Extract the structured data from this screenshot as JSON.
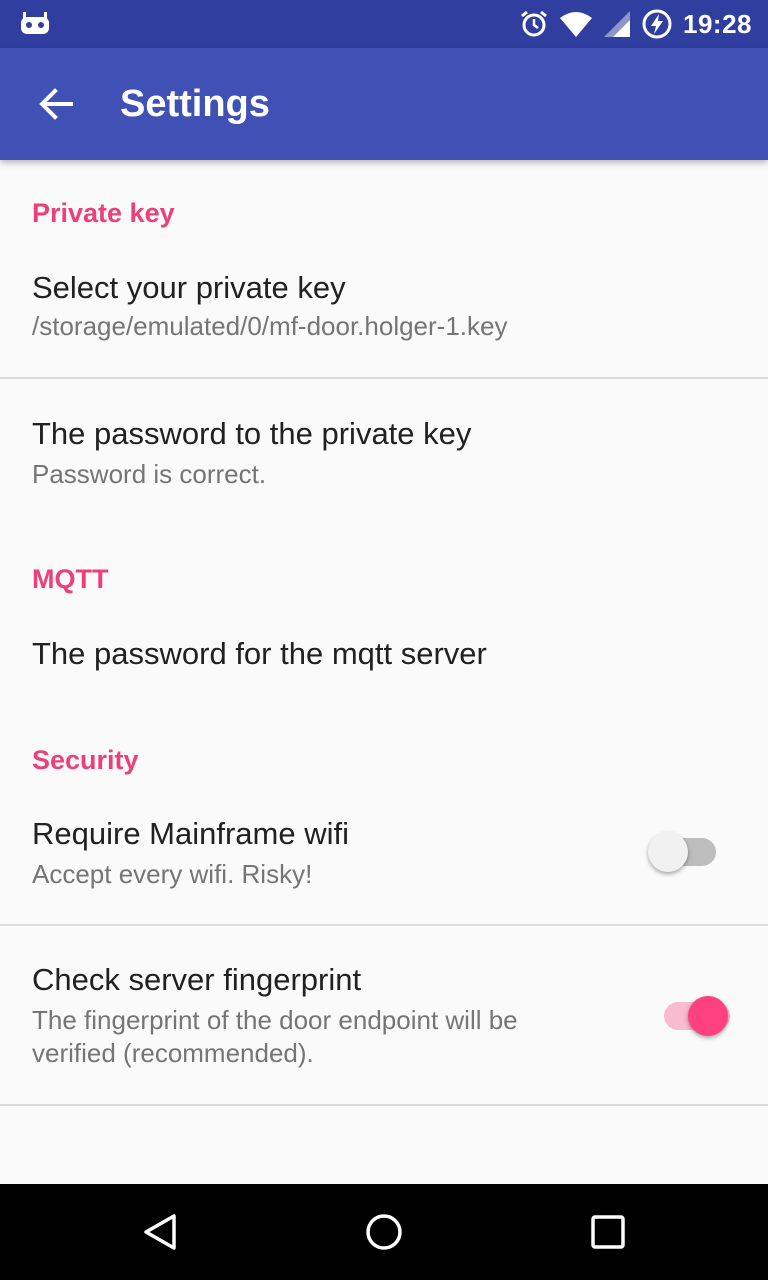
{
  "status_bar": {
    "time": "19:28",
    "icons": [
      "android-debug-icon",
      "alarm-icon",
      "wifi-icon",
      "signal-icon",
      "battery-charging-icon"
    ]
  },
  "toolbar": {
    "title": "Settings",
    "back_icon": "arrow-back-icon"
  },
  "sections": {
    "private_key": {
      "header": "Private key",
      "select_key": {
        "title": "Select your private key",
        "summary": "/storage/emulated/0/mf-door.holger-1.key"
      },
      "key_password": {
        "title": "The password to the private key",
        "summary": "Password is correct."
      }
    },
    "mqtt": {
      "header": "MQTT",
      "server_password": {
        "title": "The password for the mqtt server"
      }
    },
    "security": {
      "header": "Security",
      "require_wifi": {
        "title": "Require Mainframe wifi",
        "summary": "Accept every wifi. Risky!",
        "checked": false
      },
      "check_fingerprint": {
        "title": "Check server fingerprint",
        "summary": "The fingerprint of the door endpoint will be verified (recommended).",
        "checked": true
      }
    }
  },
  "colors": {
    "status_bar": "#303f9f",
    "toolbar": "#3f51b5",
    "accent": "#ec407a",
    "switch_on_thumb": "#ff4081",
    "switch_on_track": "#f8bbd0"
  },
  "nav_bar": {
    "icons": [
      "back-triangle-icon",
      "home-circle-icon",
      "recents-square-icon"
    ]
  }
}
